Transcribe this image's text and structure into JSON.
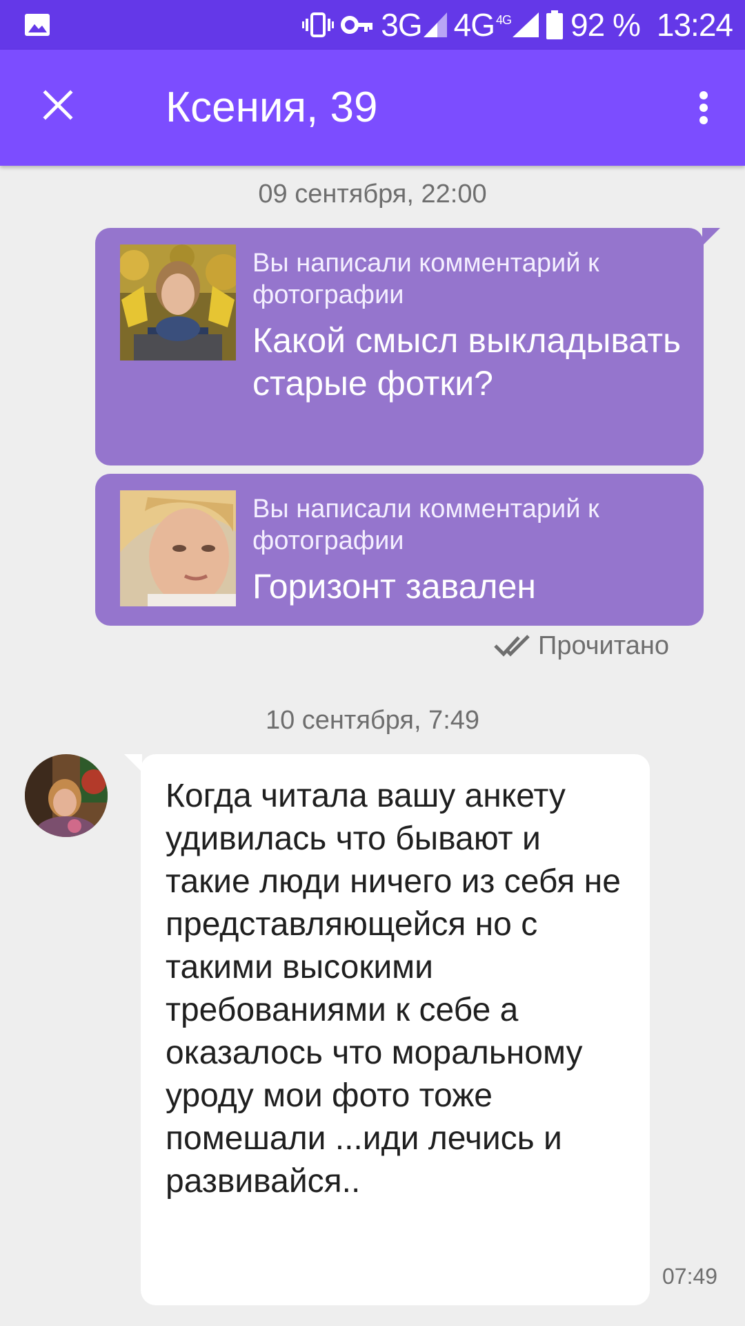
{
  "status_bar": {
    "network_3g": "3G",
    "network_4g": "4G",
    "network_4g_sup": "4G",
    "battery": "92 %",
    "time": "13:24",
    "icons": [
      "image-notification-icon",
      "vibrate-icon",
      "vpn-key-icon",
      "signal-icon",
      "battery-icon"
    ]
  },
  "app_bar": {
    "title": "Ксения, 39",
    "icons": [
      "close-icon",
      "more-vert-icon"
    ]
  },
  "chat": {
    "groups": [
      {
        "date": "09 сентября, 22:00",
        "messages": [
          {
            "caption": "Вы написали комментарий к фотографии",
            "comment": "Какой смысл выкладывать старые фотки?"
          },
          {
            "caption": "Вы написали комментарий к фотографии",
            "comment": "Горизонт завален"
          }
        ],
        "read_status": "Прочитано"
      },
      {
        "date": "10 сентября, 7:49",
        "incoming": {
          "text": "Когда читала вашу анкету удивилась что бывают и такие люди ничего из себя не представляющейся но с такими высокими требованиями к себе а оказалось что моральному уроду мои фото тоже помешали ...иди лечись и развивайся..",
          "time": "07:49"
        }
      }
    ]
  },
  "colors": {
    "status_bar": "#6438e8",
    "app_bar": "#7c4dff",
    "outgoing_bubble": "#9575cd",
    "incoming_bubble": "#ffffff",
    "background": "#eeeeee"
  }
}
